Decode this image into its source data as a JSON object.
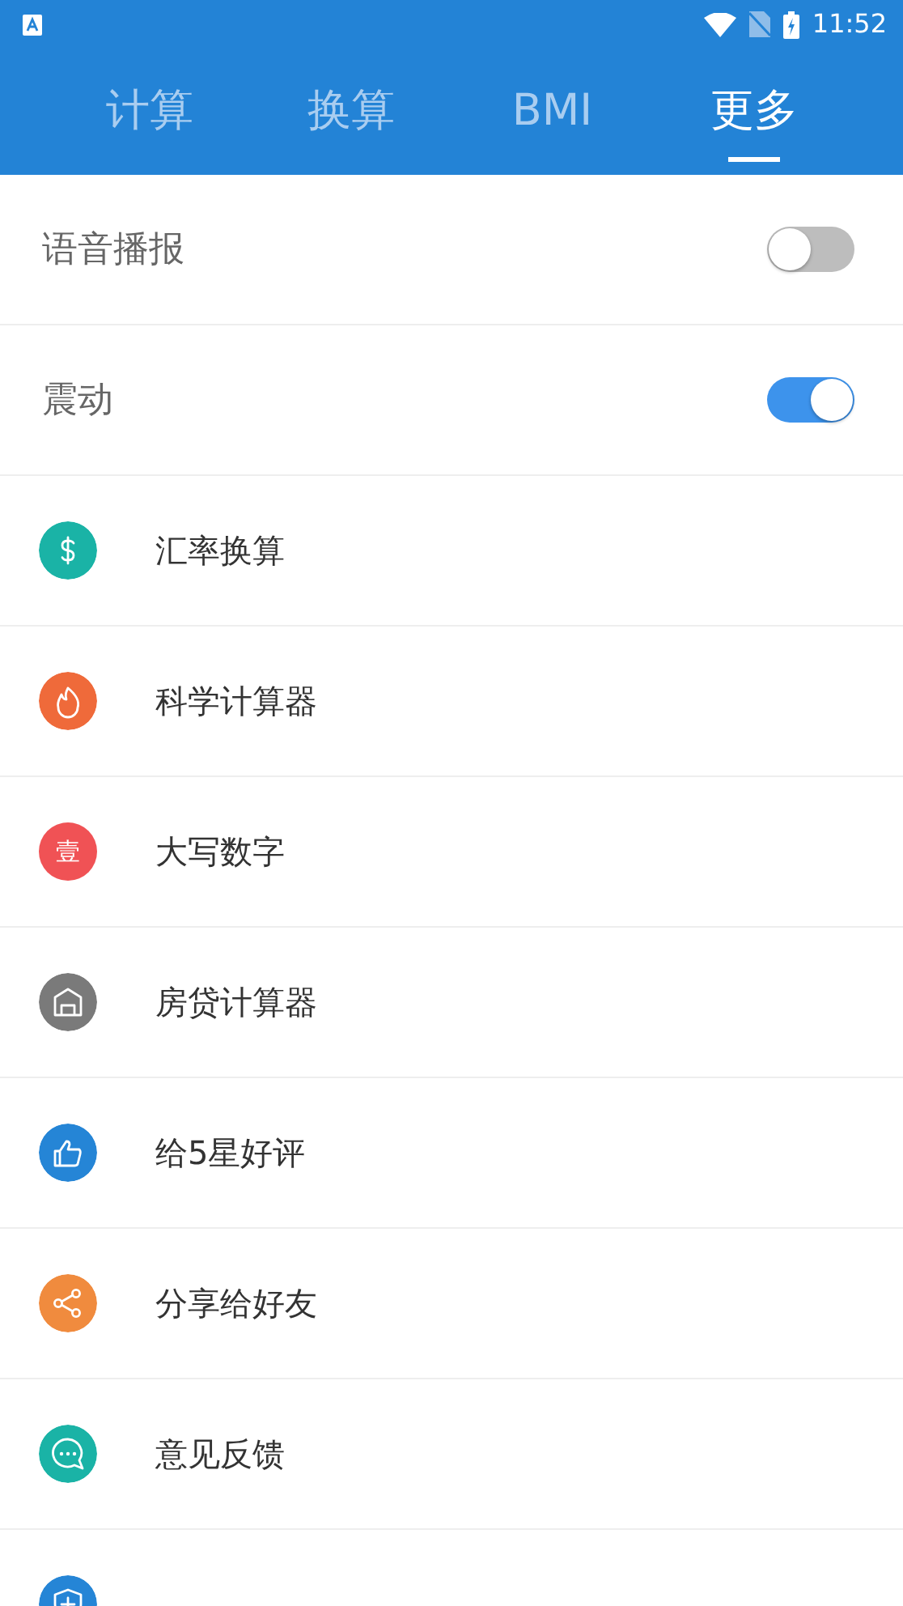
{
  "status_bar": {
    "time": "11:52"
  },
  "tabs": [
    {
      "label": "计算",
      "selected": false
    },
    {
      "label": "换算",
      "selected": false
    },
    {
      "label": "BMI",
      "selected": false
    },
    {
      "label": "更多",
      "selected": true
    }
  ],
  "settings": [
    {
      "label": "语音播报",
      "on": false
    },
    {
      "label": "震动",
      "on": true
    }
  ],
  "menu": [
    {
      "label": "汇率换算",
      "kind": "dollar",
      "color": "#1ab3a6"
    },
    {
      "label": "科学计算器",
      "kind": "flame",
      "color": "#ef6a3a"
    },
    {
      "label": "大写数字",
      "kind": "glyph",
      "glyph": "壹",
      "color": "#f05255"
    },
    {
      "label": "房贷计算器",
      "kind": "house",
      "color": "#7a7a7a"
    },
    {
      "label": "给5星好评",
      "kind": "thumb",
      "color": "#2585d6"
    },
    {
      "label": "分享给好友",
      "kind": "share",
      "color": "#f08b3e"
    },
    {
      "label": "意见反馈",
      "kind": "chat",
      "color": "#1ab3a6"
    },
    {
      "kind": "shield",
      "color": "#2585d6"
    }
  ]
}
